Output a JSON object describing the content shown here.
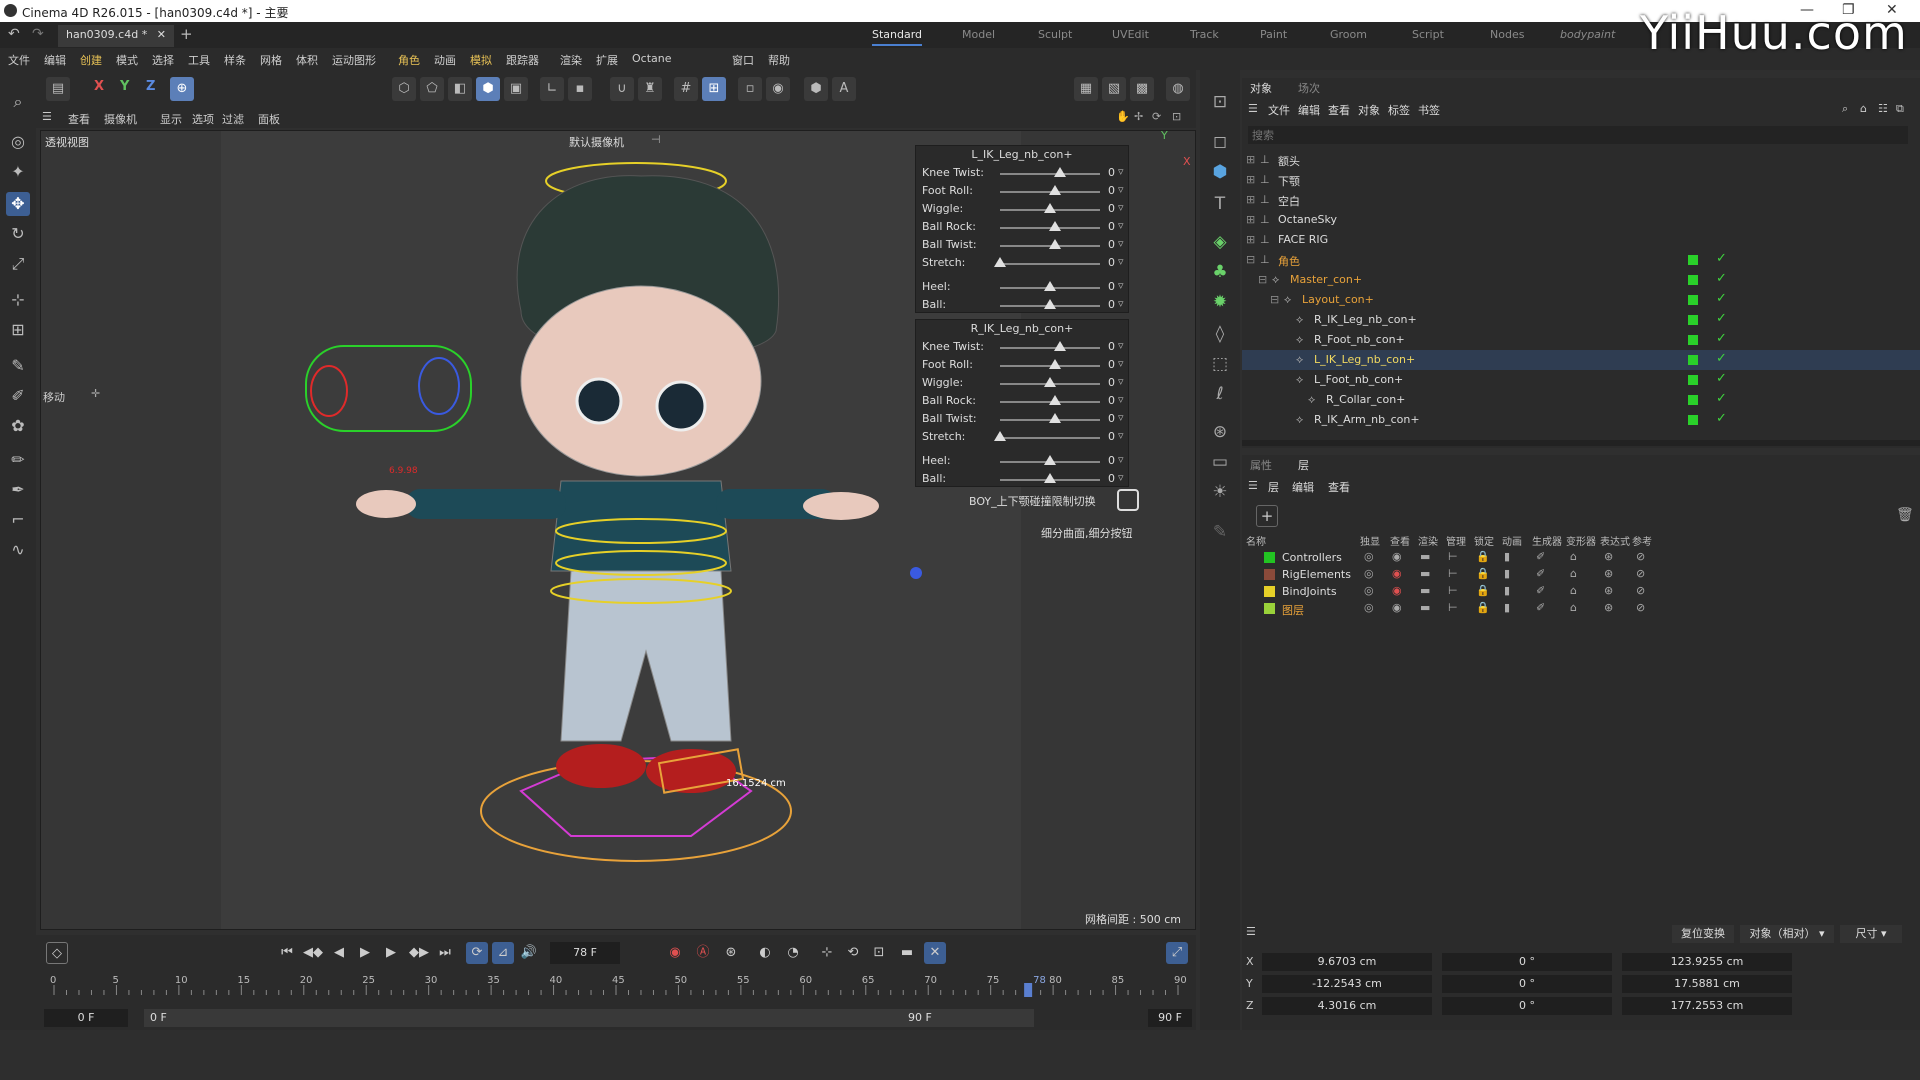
{
  "title_bar": {
    "title": "Cinema 4D R26.015 - [han0309.c4d *] - 主要"
  },
  "doc_tab": {
    "label": "han0309.c4d *"
  },
  "layout_tabs": [
    "Standard",
    "Model",
    "Sculpt",
    "UVEdit",
    "Track",
    "Paint",
    "Groom",
    "Script",
    "Nodes",
    "bodypaint"
  ],
  "watermark": "YiiHuu.com",
  "menu": [
    "文件",
    "编辑",
    "创建",
    "模式",
    "选择",
    "工具",
    "样条",
    "网格",
    "体积",
    "运动图形",
    "角色",
    "动画",
    "模拟",
    "跟踪器",
    "渲染",
    "扩展",
    "Octane",
    "窗口",
    "帮助"
  ],
  "viewport_menu": [
    "查看",
    "摄像机",
    "显示",
    "选项",
    "过滤",
    "面板"
  ],
  "viewport": {
    "name": "透视视图",
    "camera": "默认摄像机",
    "grid_spacing": "网格间距 : 500 cm",
    "move_label": "移动",
    "measure": "16.1524 cm",
    "measure2": "6.9.98"
  },
  "rig_panels": [
    {
      "title": "L_IK_Leg_nb_con+",
      "rows": [
        {
          "label": "Knee Twist:",
          "value": "0",
          "pos": 0.6
        },
        {
          "label": "Foot Roll:",
          "value": "0",
          "pos": 0.55
        },
        {
          "label": "Wiggle:",
          "value": "0",
          "pos": 0.5
        },
        {
          "label": "Ball Rock:",
          "value": "0",
          "pos": 0.55
        },
        {
          "label": "Ball Twist:",
          "value": "0",
          "pos": 0.55
        },
        {
          "label": "Stretch:",
          "value": "0",
          "pos": 0.0
        },
        {
          "label": "Heel:",
          "value": "0",
          "pos": 0.5
        },
        {
          "label": "Ball:",
          "value": "0",
          "pos": 0.5
        }
      ]
    },
    {
      "title": "R_IK_Leg_nb_con+",
      "rows": [
        {
          "label": "Knee Twist:",
          "value": "0",
          "pos": 0.6
        },
        {
          "label": "Foot Roll:",
          "value": "0",
          "pos": 0.55
        },
        {
          "label": "Wiggle:",
          "value": "0",
          "pos": 0.5
        },
        {
          "label": "Ball Rock:",
          "value": "0",
          "pos": 0.55
        },
        {
          "label": "Ball Twist:",
          "value": "0",
          "pos": 0.55
        },
        {
          "label": "Stretch:",
          "value": "0",
          "pos": 0.0
        },
        {
          "label": "Heel:",
          "value": "0",
          "pos": 0.5
        },
        {
          "label": "Ball:",
          "value": "0",
          "pos": 0.5
        }
      ]
    }
  ],
  "rig_extra": {
    "toggle_label": "BOY_上下颚碰撞限制切换",
    "subdiv_label": "细分曲面,细分按钮"
  },
  "timeline": {
    "current_frame": "78 F",
    "start_field": "0 F",
    "start_field2": "0 F",
    "end_field": "90 F",
    "end_field2": "90 F",
    "playhead": "78",
    "ticks": [
      "0",
      "5",
      "10",
      "15",
      "20",
      "25",
      "30",
      "35",
      "40",
      "45",
      "50",
      "55",
      "60",
      "65",
      "70",
      "75",
      "80",
      "85",
      "90"
    ]
  },
  "object_manager": {
    "tabs": [
      "对象",
      "场次"
    ],
    "menu": [
      "文件",
      "编辑",
      "查看",
      "对象",
      "标签",
      "书签"
    ],
    "search_placeholder": "搜索",
    "rows": [
      {
        "name": "额头",
        "indent": 0,
        "highlight": false
      },
      {
        "name": "下颚",
        "indent": 0,
        "highlight": false
      },
      {
        "name": "空白",
        "indent": 0,
        "highlight": false
      },
      {
        "name": "OctaneSky",
        "indent": 0,
        "highlight": false
      },
      {
        "name": "FACE RIG",
        "indent": 0,
        "highlight": false
      },
      {
        "name": "角色",
        "indent": 0,
        "highlight": true
      },
      {
        "name": "Master_con+",
        "indent": 1,
        "highlight": true
      },
      {
        "name": "Layout_con+",
        "indent": 2,
        "highlight": true
      },
      {
        "name": "R_IK_Leg_nb_con+",
        "indent": 3,
        "highlight": false
      },
      {
        "name": "R_Foot_nb_con+",
        "indent": 3,
        "highlight": false
      },
      {
        "name": "L_IK_Leg_nb_con+",
        "indent": 3,
        "highlight": false,
        "selected": true
      },
      {
        "name": "L_Foot_nb_con+",
        "indent": 3,
        "highlight": false
      },
      {
        "name": "R_Collar_con+",
        "indent": 4,
        "highlight": false
      },
      {
        "name": "R_IK_Arm_nb_con+",
        "indent": 3,
        "highlight": false
      }
    ]
  },
  "layer_manager": {
    "tabs": [
      "属性",
      "层"
    ],
    "menu": [
      "层",
      "编辑",
      "查看"
    ],
    "columns": [
      "名称",
      "独显",
      "查看",
      "渲染",
      "管理",
      "锁定",
      "动画",
      "生成器",
      "变形器",
      "表达式",
      "参考"
    ],
    "rows": [
      {
        "name": "Controllers",
        "color": "#22c322"
      },
      {
        "name": "RigElements",
        "color": "#8a4a3a"
      },
      {
        "name": "BindJoints",
        "color": "#e6d028"
      },
      {
        "name": "图层",
        "color": "#9ad23a",
        "highlight": true
      }
    ]
  },
  "coords": {
    "buttons": [
      "复位变换",
      "对象（相对）",
      "尺寸"
    ],
    "rows": [
      {
        "axis": "X",
        "pos": "9.6703 cm",
        "rot": "0 °",
        "size": "123.9255 cm"
      },
      {
        "axis": "Y",
        "pos": "-12.2543 cm",
        "rot": "0 °",
        "size": "17.5881 cm"
      },
      {
        "axis": "Z",
        "pos": "4.3016 cm",
        "rot": "0 °",
        "size": "177.2553 cm"
      }
    ]
  },
  "colors": {
    "accent": "#4a7fd0",
    "green": "#2ad12a",
    "orange": "#e8a23a"
  }
}
